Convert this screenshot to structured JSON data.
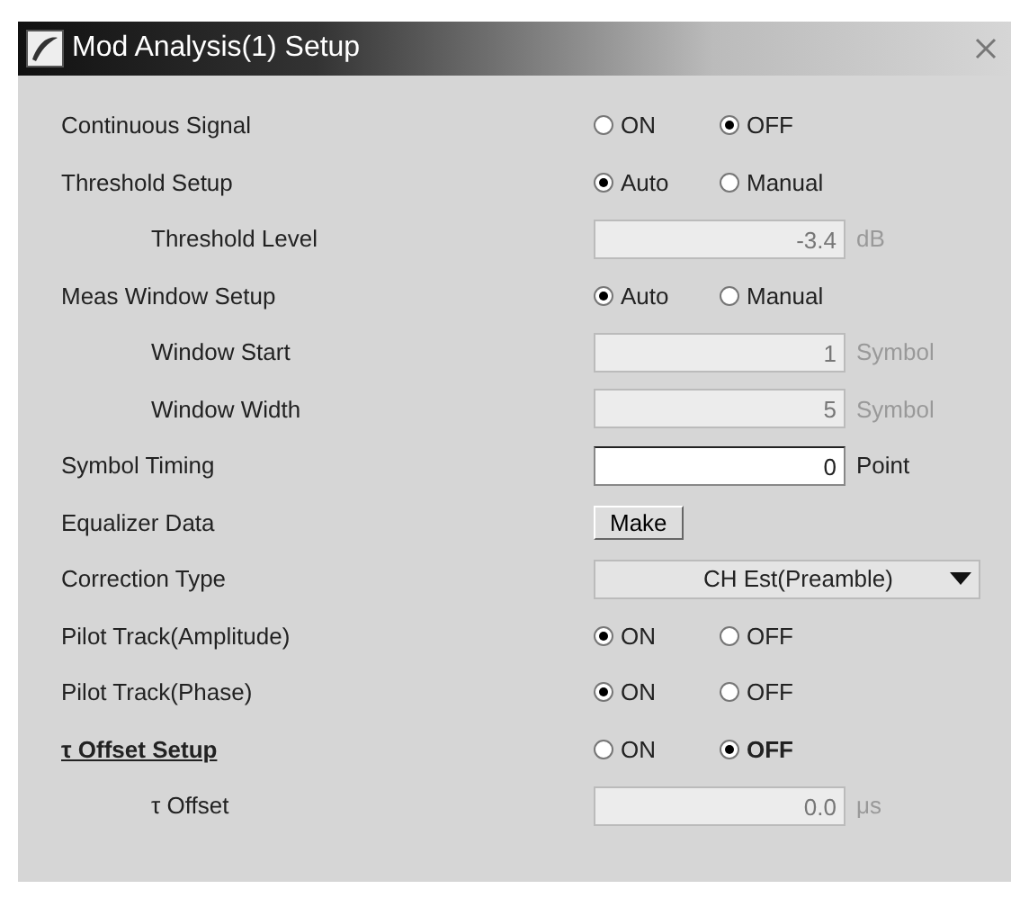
{
  "window": {
    "title": "Mod Analysis(1) Setup"
  },
  "rows": [
    {
      "kind": "radio",
      "label": "Continuous Signal",
      "options": [
        {
          "label": "ON",
          "selected": false
        },
        {
          "label": "OFF",
          "selected": true
        }
      ]
    },
    {
      "kind": "radio",
      "label": "Threshold Setup",
      "options": [
        {
          "label": "Auto",
          "selected": true
        },
        {
          "label": "Manual",
          "selected": false
        }
      ],
      "children": [
        {
          "kind": "field",
          "label": "Threshold Level",
          "value": "-3.4",
          "unit": "dB",
          "disabled": true
        }
      ]
    },
    {
      "kind": "radio",
      "label": "Meas Window Setup",
      "options": [
        {
          "label": "Auto",
          "selected": true
        },
        {
          "label": "Manual",
          "selected": false
        }
      ],
      "children": [
        {
          "kind": "field",
          "label": "Window Start",
          "value": "1",
          "unit": "Symbol",
          "disabled": true
        },
        {
          "kind": "field",
          "label": "Window Width",
          "value": "5",
          "unit": "Symbol",
          "disabled": true
        }
      ]
    },
    {
      "kind": "field",
      "label": "Symbol Timing",
      "value": "0",
      "unit": "Point",
      "disabled": false
    },
    {
      "kind": "button",
      "label": "Equalizer Data",
      "button": "Make"
    },
    {
      "kind": "dropdown",
      "label": "Correction Type",
      "value": "CH Est(Preamble)"
    },
    {
      "kind": "radio",
      "label": "Pilot Track(Amplitude)",
      "options": [
        {
          "label": "ON",
          "selected": true
        },
        {
          "label": "OFF",
          "selected": false
        }
      ]
    },
    {
      "kind": "radio",
      "label": "Pilot Track(Phase)",
      "options": [
        {
          "label": "ON",
          "selected": true
        },
        {
          "label": "OFF",
          "selected": false
        }
      ]
    },
    {
      "kind": "radio",
      "label": "τ Offset Setup",
      "focused": true,
      "options": [
        {
          "label": "ON",
          "selected": false
        },
        {
          "label": "OFF",
          "selected": true
        }
      ],
      "children": [
        {
          "kind": "field",
          "label": "τ Offset",
          "value": "0.0",
          "unit": "μs",
          "disabled": true
        }
      ]
    }
  ]
}
